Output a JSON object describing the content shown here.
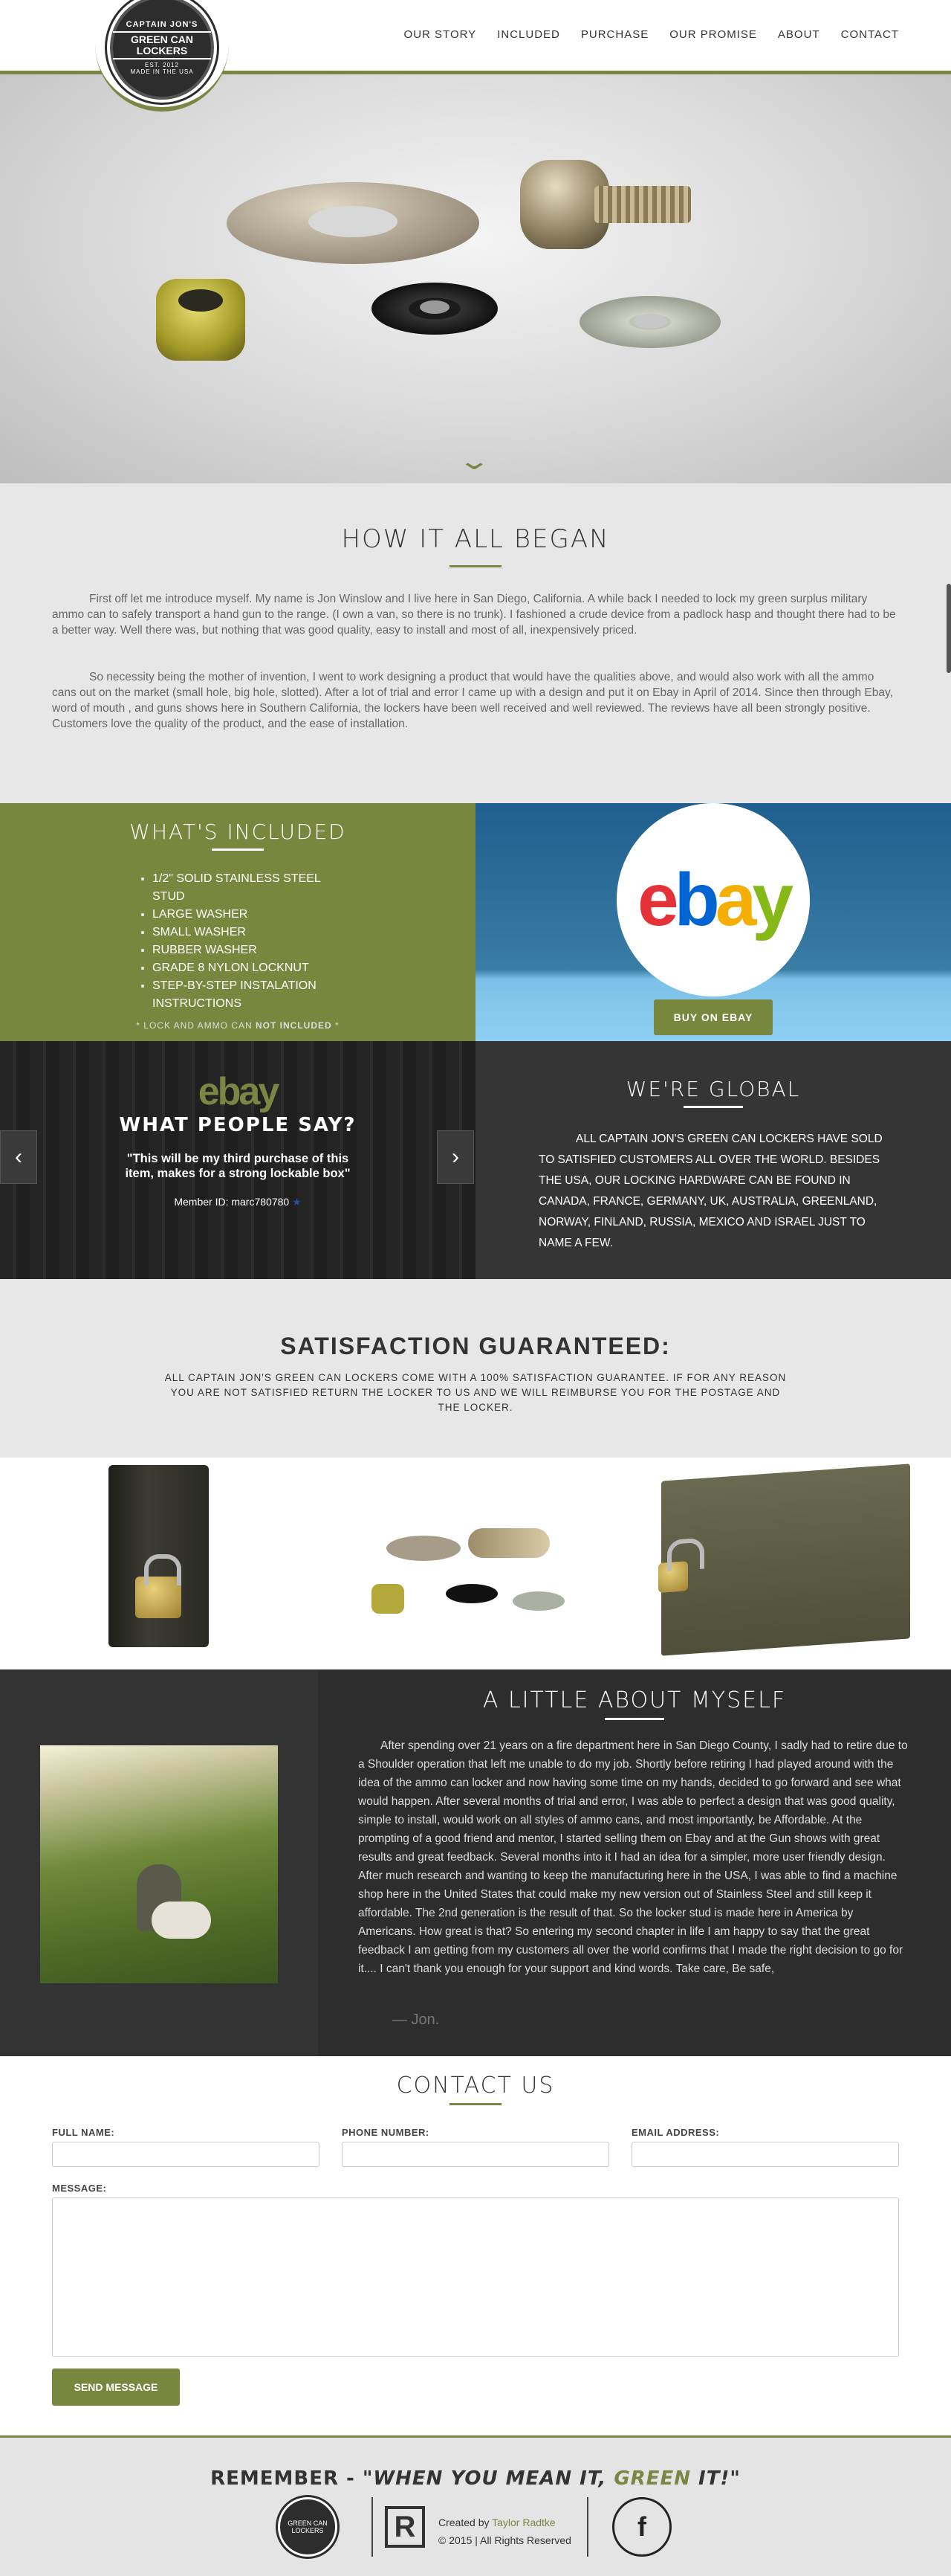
{
  "brand": {
    "top": "CAPTAIN JON'S",
    "name": "GREEN CAN LOCKERS",
    "est": "EST. 2012",
    "bottom": "MADE IN THE USA"
  },
  "nav": [
    "OUR STORY",
    "INCLUDED",
    "PURCHASE",
    "OUR PROMISE",
    "ABOUT",
    "CONTACT"
  ],
  "hero": {
    "scroll_icon": "chevron-down-icon",
    "scroll_glyph": "⌄"
  },
  "story": {
    "title": "HOW IT ALL BEGAN",
    "p1": "First off let me introduce myself. My name is Jon Winslow and I live here in San Diego, California. A while back I needed to lock my green surplus military ammo can to safely transport a hand gun to the range. (I own a van, so there is no trunk). I fashioned a crude device from a padlock hasp and thought there had to be a better way. Well there was, but nothing that was good quality, easy to install and most of all, inexpensively priced.",
    "p2": "So necessity being the mother of invention, I went to work designing a product that would have the qualities above, and would also work with all the ammo cans out on the market (small hole, big hole, slotted). After a lot of trial and error I came up with a design and put it on Ebay in April of 2014. Since then through Ebay, word of mouth , and guns shows here in Southern California, the lockers have been well received and well reviewed. The reviews have all been strongly positive. Customers love the quality of the product, and the ease of installation."
  },
  "included": {
    "title": "WHAT'S INCLUDED",
    "items": [
      "1/2\" SOLID STAINLESS STEEL STUD",
      "LARGE WASHER",
      "SMALL WASHER",
      "RUBBER WASHER",
      "GRADE 8 NYLON LOCKNUT",
      "STEP-BY-STEP INSTALATION INSTRUCTIONS"
    ],
    "note_prefix": "* LOCK AND AMMO CAN ",
    "note_bold": "NOT INCLUDED",
    "note_suffix": " *"
  },
  "ebay": {
    "logo_letters": [
      "e",
      "b",
      "a",
      "y"
    ],
    "logo_colors": [
      "#e53238",
      "#0064d2",
      "#f5af02",
      "#86b817"
    ],
    "buy_label": "BUY ON EBAY"
  },
  "testimonial": {
    "logo": "ebay",
    "title": "WHAT PEOPLE SAY?",
    "quote": "\"This will be my third purchase of this item, makes for a strong lockable box\"",
    "member": "Member ID: marc780780",
    "prev_glyph": "‹",
    "next_glyph": "›"
  },
  "global": {
    "title": "WE'RE GLOBAL",
    "text": "All Captain Jon's Green Can Lockers have sold to satisfied customers all over the world. Besides the USA, our locking hardware can be found in Canada, France, Germany, UK, Australia, Greenland, Norway, Finland, Russia, Mexico and Israel just to name a few."
  },
  "guarantee": {
    "title": "SATISFACTION GUARANTEED:",
    "text": "All Captain Jon's Green Can Lockers come with a 100% satisfaction guarantee. If for any reason you are not satisfied return the locker to us and we will reimburse you for the postage and the locker."
  },
  "about": {
    "title": "A LITTLE ABOUT MYSELF",
    "text": "After spending over 21 years on a fire department here in San Diego County, I sadly had to retire due to a Shoulder operation that left me unable to do my job. Shortly before retiring I had played around with the idea of the ammo can locker and now having some time on my hands, decided to go forward and see what would happen. After several months of trial and error, I was able to perfect a design that was good quality, simple to install, would work on all styles of ammo cans, and most importantly, be Affordable. At the prompting of a good friend and mentor, I started selling them on Ebay and at the Gun shows with great results and great feedback. Several months into it I had an idea for a simpler, more user friendly design. After much research and wanting to keep the manufacturing here in the USA, I was able to find a machine shop here in the United States that could make my new version out of Stainless Steel and still keep it affordable. The 2nd generation is the result of that. So the locker stud is made here in America by Americans. How great is that? So entering my second chapter in life I am happy to say that the great feedback I am getting from my customers all over the world confirms that I made the right decision to go for it.... I can't thank you enough for your support and kind words. Take care, Be safe,",
    "signature": "— Jon."
  },
  "contact": {
    "title": "CONTACT US",
    "full_name_label": "FULL NAME:",
    "phone_label": "PHONE NUMBER:",
    "email_label": "EMAIL ADDRESS:",
    "message_label": "MESSAGE:",
    "send_label": "SEND MESSAGE"
  },
  "footer": {
    "remember": "REMEMBER - ",
    "slogan_1": "\"WHEN YOU MEAN IT, ",
    "slogan_green": "GREEN",
    "slogan_2": " IT!\"",
    "credit_prefix": "Created by ",
    "credit_name": "Taylor Radtke",
    "copyright": "© 2015 | All Rights Reserved",
    "r_logo": "R",
    "fb_glyph": "f"
  }
}
